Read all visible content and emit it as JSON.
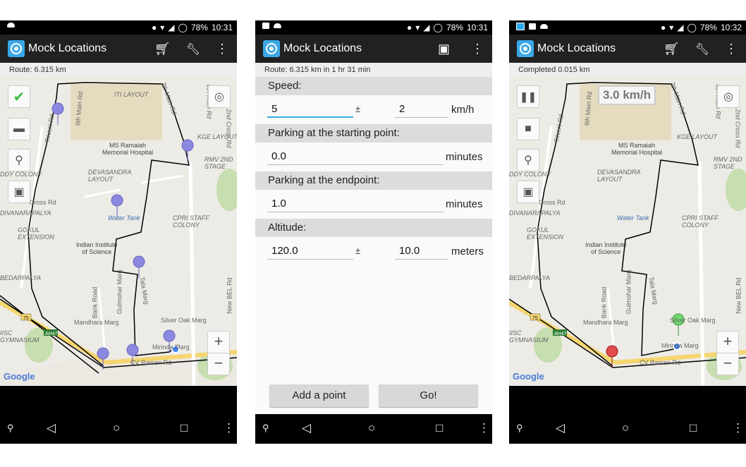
{
  "screens": [
    {
      "status": {
        "battery": "78%",
        "time": "10:31"
      },
      "app_title": "Mock Locations",
      "info": "Route: 6.315 km"
    },
    {
      "status": {
        "battery": "78%",
        "time": "10:31"
      },
      "app_title": "Mock Locations",
      "info": "Route: 6.315 km in 1 hr 31 min",
      "form": {
        "speed_label": "Speed:",
        "speed_value": "5",
        "speed_pm": "±",
        "speed_var": "2",
        "speed_unit": "km/h",
        "park_start_label": "Parking at the starting point:",
        "park_start_value": "0.0",
        "park_start_unit": "minutes",
        "park_end_label": "Parking at the endpoint:",
        "park_end_value": "1.0",
        "park_end_unit": "minutes",
        "alt_label": "Altitude:",
        "alt_value": "120.0",
        "alt_pm": "±",
        "alt_var": "10.0",
        "alt_unit": "meters"
      },
      "buttons": {
        "add_point": "Add a point",
        "go": "Go!"
      }
    },
    {
      "status": {
        "battery": "78%",
        "time": "10:32"
      },
      "app_title": "Mock Locations",
      "info": "Completed 0.015 km",
      "speed_badge": "3.0 km/h"
    }
  ],
  "map_labels": {
    "itl": "ITI LAYOUT",
    "seventh": "7th Main Rd",
    "eighth": "8th Main Rd",
    "kge": "KGE LAYOUT",
    "second_cross": "2nd Cross Rd",
    "ramaiah": "MS Ramaiah\nMemorial Hospital",
    "rmv": "RMV 2ND\nSTAGE",
    "devasandra": "DEVASANDRA\nLAYOUT",
    "ddy": "DDY COLONY",
    "cross": "Cross Rd",
    "divanarapalya": "DIVANARAPALYA",
    "watertank": "Water Tank",
    "cpri": "CPRI STAFF\nCOLONY",
    "gokul": "GOKUL\nEXTENSION",
    "iisc": "Indian Institute\nof Science",
    "bedarpalya": "BEDARPALYA",
    "bank": "Bank Road",
    "gulmohar": "Gulmohar Marg",
    "tala": "Tala Marg",
    "newbel": "New BEL Rd",
    "silveroak": "Silver Oak Marg",
    "mandhara": "Mandhara Marg",
    "mirinda": "Mirinda Marg",
    "cvraman": "CV Raman Rd",
    "iisc_gym": "IISC\nGYMNASIUM",
    "ah47": "AH47",
    "r75": "75",
    "triveni": "Triveni Rd",
    "sixth": "6th Main Rd",
    "google": "Google"
  },
  "icons": {
    "check": "check-icon",
    "trash": "trash-icon",
    "search": "search-icon",
    "save": "save-icon",
    "cart": "cart-icon",
    "wrench": "wrench-icon",
    "menu": "overflow-menu-icon",
    "locate": "my-location-icon",
    "pause": "pause-icon",
    "stop": "stop-icon"
  },
  "zoom": {
    "in": "+",
    "out": "−"
  },
  "nav": {
    "back": "◁",
    "home": "○",
    "recents": "□",
    "search": "⚲",
    "menu": "⋮"
  }
}
